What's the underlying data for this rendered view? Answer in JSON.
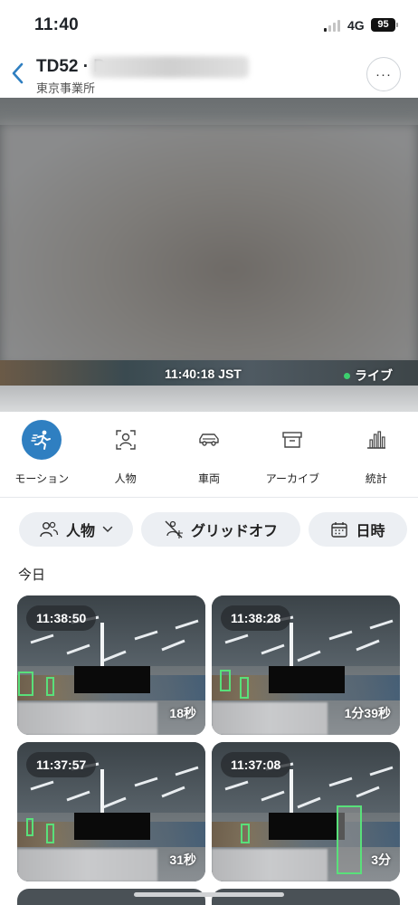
{
  "status_bar": {
    "time": "11:40",
    "network": "4G",
    "battery": "95"
  },
  "header": {
    "title": "TD52 · D",
    "subtitle": "東京事業所",
    "more_icon": "more-horizontal-icon"
  },
  "video": {
    "timestamp": "11:40:18 JST",
    "live_label": "ライブ",
    "live_color": "#3ccf6e"
  },
  "filter_tabs": [
    {
      "label": "モーション",
      "icon": "motion-icon",
      "active": true
    },
    {
      "label": "人物",
      "icon": "person-icon",
      "active": false
    },
    {
      "label": "車両",
      "icon": "vehicle-icon",
      "active": false
    },
    {
      "label": "アーカイブ",
      "icon": "archive-icon",
      "active": false
    },
    {
      "label": "統計",
      "icon": "stats-icon",
      "active": false
    }
  ],
  "chips": {
    "people": {
      "label": "人物",
      "icon": "people-icon"
    },
    "grid": {
      "label": "グリッドオフ",
      "icon": "grid-off-icon"
    },
    "date": {
      "label": "日時",
      "icon": "calendar-icon"
    }
  },
  "section_label": "今日",
  "events": [
    {
      "time": "11:38:50",
      "duration": "18秒"
    },
    {
      "time": "11:38:28",
      "duration": "1分39秒"
    },
    {
      "time": "11:37:57",
      "duration": "31秒"
    },
    {
      "time": "11:37:08",
      "duration": "3分"
    }
  ],
  "colors": {
    "accent": "#2f7fc1",
    "detection_box": "#59e07a"
  }
}
